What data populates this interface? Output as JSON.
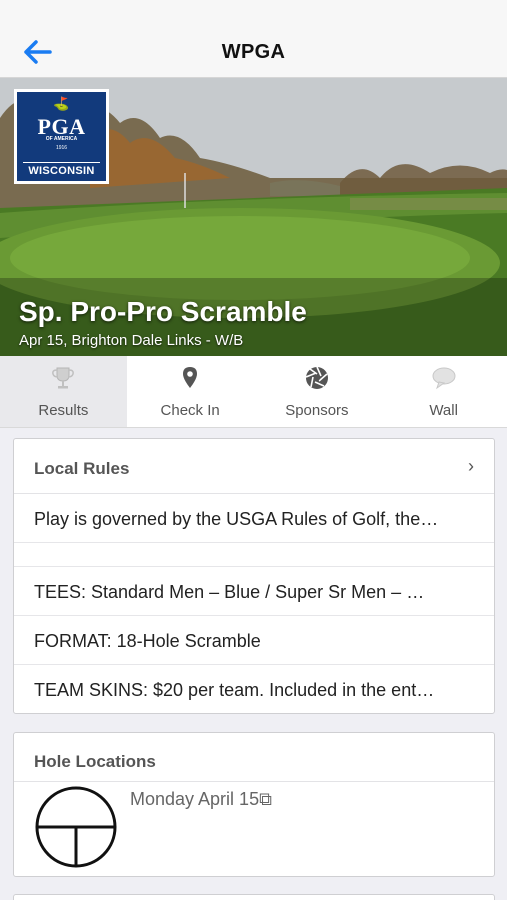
{
  "nav": {
    "title": "WPGA",
    "back_icon": "arrow-left-icon",
    "accent": "#1a7cf2"
  },
  "hero": {
    "logo": {
      "pga": "PGA",
      "sub": "OF AMERICA",
      "year": "1916",
      "state": "WISCONSIN"
    },
    "title": "Sp. Pro-Pro Scramble",
    "subtitle": "Apr 15, Brighton Dale Links - W/B"
  },
  "tabs": [
    {
      "label": "Results",
      "icon": "trophy-icon",
      "active": true
    },
    {
      "label": "Check In",
      "icon": "map-pin-icon",
      "active": false
    },
    {
      "label": "Sponsors",
      "icon": "aperture-icon",
      "active": false
    },
    {
      "label": "Wall",
      "icon": "speech-bubble-icon",
      "active": false
    }
  ],
  "local_rules": {
    "header": "Local Rules",
    "rows": [
      "Play is governed by the USGA Rules of Golf, the…",
      "",
      "TEES: Standard Men – Blue / Super Sr Men – …",
      "FORMAT: 18-Hole Scramble",
      "TEAM SKINS: $20 per team. Included in the ent…"
    ]
  },
  "hole_locations": {
    "header": "Hole Locations",
    "link": "Monday April 15⧉"
  }
}
